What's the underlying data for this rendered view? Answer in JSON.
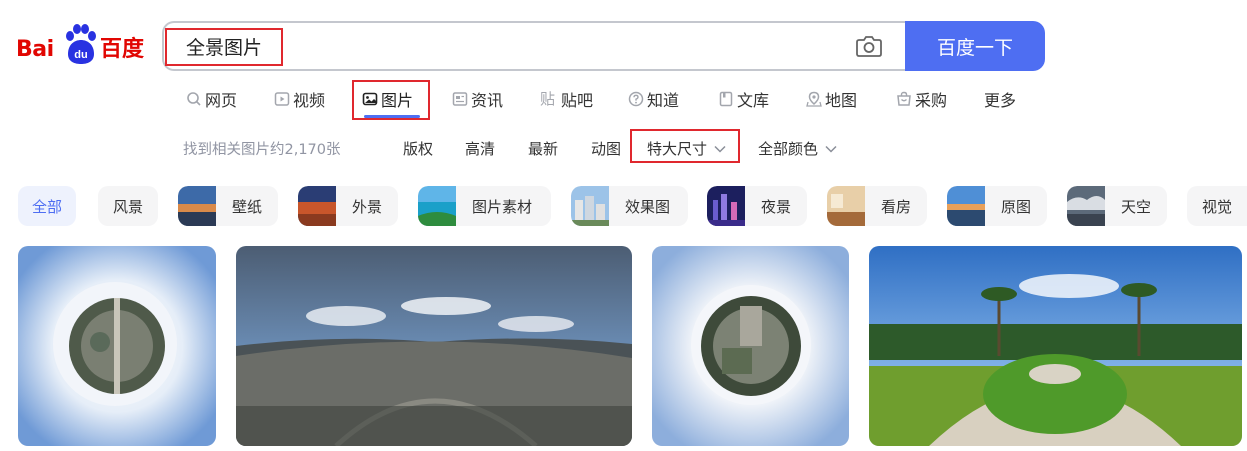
{
  "logo": {
    "text_left": "Bai",
    "text_paw": "du",
    "text_right": "百度",
    "icon": "baidu-paw-icon"
  },
  "search": {
    "query": "全景图片",
    "placeholder": "",
    "camera_icon": "camera-icon",
    "button_label": "百度一下"
  },
  "tabs": [
    {
      "label": "网页",
      "icon": "search-icon"
    },
    {
      "label": "视频",
      "icon": "play-icon"
    },
    {
      "label": "图片",
      "icon": "image-icon",
      "active": true
    },
    {
      "label": "资讯",
      "icon": "news-icon"
    },
    {
      "label": "贴吧",
      "icon": "tieba-icon"
    },
    {
      "label": "知道",
      "icon": "question-icon"
    },
    {
      "label": "文库",
      "icon": "document-icon"
    },
    {
      "label": "地图",
      "icon": "map-pin-icon"
    },
    {
      "label": "采购",
      "icon": "cart-icon"
    },
    {
      "label": "更多",
      "icon": ""
    }
  ],
  "filters": {
    "result_count": "找到相关图片约2,170张",
    "items": [
      "版权",
      "高清",
      "最新",
      "动图",
      "特大尺寸",
      "全部颜色"
    ]
  },
  "tags": [
    "全部",
    "风景",
    "壁纸",
    "外景",
    "图片素材",
    "效果图",
    "夜景",
    "看房",
    "原图",
    "天空",
    "视觉"
  ],
  "results": [
    {
      "kind": "tiny-planet",
      "alt": ""
    },
    {
      "kind": "panorama-city",
      "alt": ""
    },
    {
      "kind": "tiny-planet",
      "alt": ""
    },
    {
      "kind": "panorama-garden",
      "alt": ""
    }
  ],
  "colors": {
    "accent": "#4e6ef2",
    "brand_red": "#e10602",
    "brand_blue": "#2932e1",
    "highlight": "#e0282e"
  }
}
